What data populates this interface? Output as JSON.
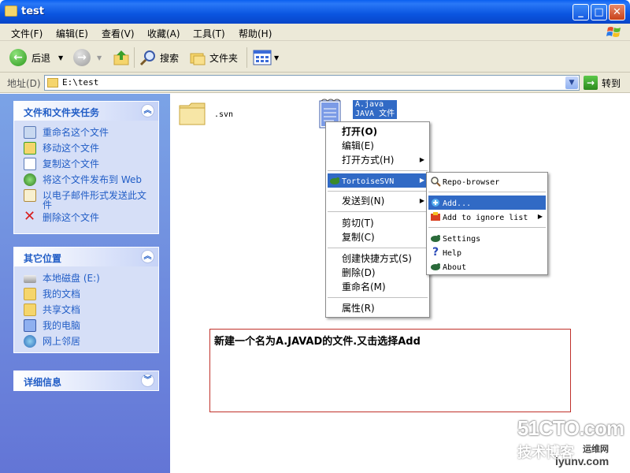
{
  "window": {
    "title": "test"
  },
  "menubar": [
    "文件(F)",
    "编辑(E)",
    "查看(V)",
    "收藏(A)",
    "工具(T)",
    "帮助(H)"
  ],
  "toolbar": {
    "back": "后退",
    "search": "搜索",
    "folders": "文件夹"
  },
  "address": {
    "label": "地址(D)",
    "value": "E:\\test",
    "go": "转到"
  },
  "tasks_panel": {
    "title": "文件和文件夹任务",
    "items": [
      "重命名这个文件",
      "移动这个文件",
      "复制这个文件",
      "将这个文件发布到 Web",
      "以电子邮件形式发送此文件",
      "删除这个文件"
    ]
  },
  "other_panel": {
    "title": "其它位置",
    "items": [
      "本地磁盘 (E:)",
      "我的文档",
      "共享文档",
      "我的电脑",
      "网上邻居"
    ]
  },
  "details_panel": {
    "title": "详细信息"
  },
  "files": [
    {
      "name": ".svn"
    },
    {
      "name": "A.java",
      "type": "JAVA 文件"
    }
  ],
  "context_menu": {
    "items": [
      "打开(O)",
      "编辑(E)",
      "打开方式(H)",
      "TortoiseSVN",
      "发送到(N)",
      "剪切(T)",
      "复制(C)",
      "创建快捷方式(S)",
      "删除(D)",
      "重命名(M)",
      "属性(R)"
    ]
  },
  "svn_submenu": {
    "items": [
      "Repo-browser",
      "Add...",
      "Add to ignore list",
      "Settings",
      "Help",
      "About"
    ]
  },
  "annotation": "新建一个名为A.JAVAD的文件.又击选择Add",
  "watermark": {
    "site": "51CTO.com",
    "cn": "技术博客",
    "cn2": "运维网",
    "url": "iyunv.com"
  },
  "colors": {
    "titlebar": "#0a55e0",
    "taskpane": "#6375d6",
    "highlight": "#316ac5"
  }
}
